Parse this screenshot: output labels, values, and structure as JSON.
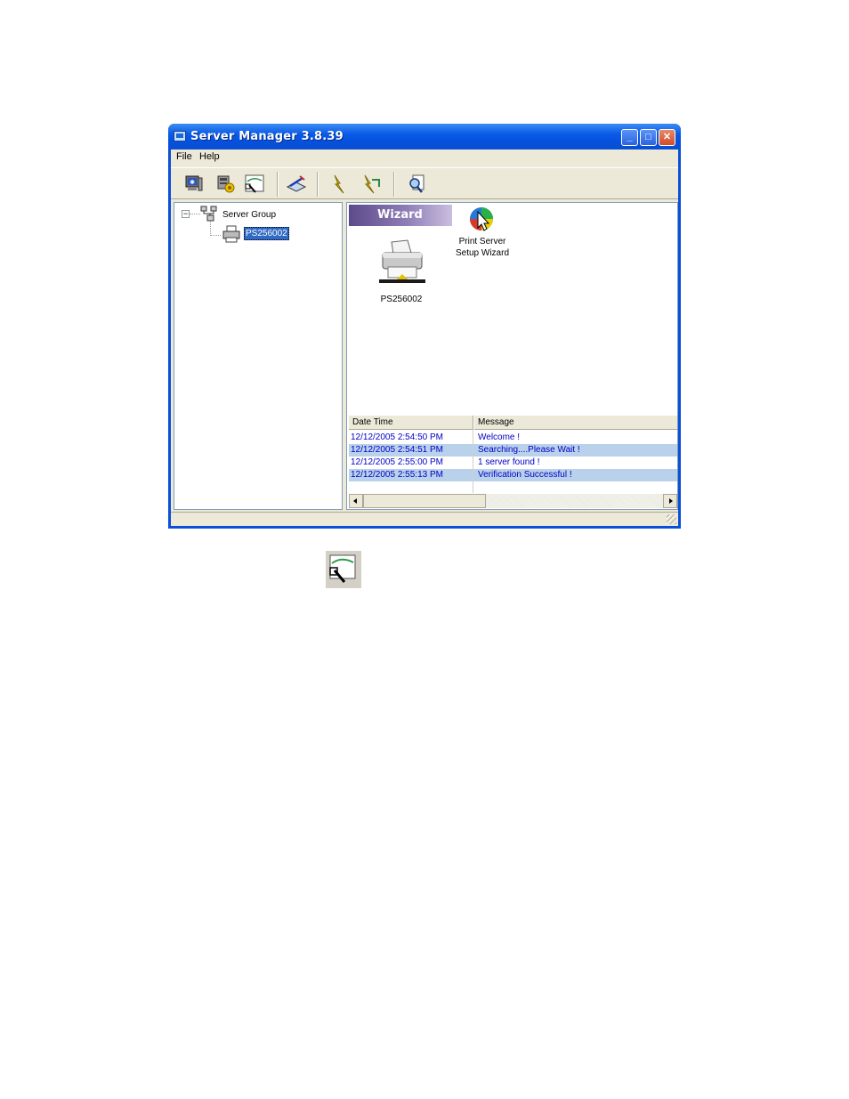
{
  "window": {
    "title": "Server Manager 3.8.39",
    "controls": {
      "minimize_glyph": "_",
      "maximize_glyph": "□",
      "close_glyph": "✕"
    }
  },
  "menu": {
    "file": "File",
    "help": "Help"
  },
  "toolbar": {
    "buttons": [
      "monitor-icon",
      "settings-icon",
      "wizard-icon",
      "edit-icon",
      "lightning-icon",
      "lightning-arrow-icon",
      "search-icon"
    ]
  },
  "tree": {
    "expander_glyph": "−",
    "group_label": "Server Group",
    "server_label": "PS256002"
  },
  "content": {
    "wizard_banner": "Wizard",
    "wizard_label_line1": "Print Server",
    "wizard_label_line2": "Setup Wizard",
    "server_label": "PS256002"
  },
  "log": {
    "columns": {
      "datetime": "Date Time",
      "message": "Message"
    },
    "rows": [
      {
        "datetime": "12/12/2005 2:54:50 PM",
        "message": "Welcome !"
      },
      {
        "datetime": "12/12/2005 2:54:51 PM",
        "message": "Searching....Please Wait !"
      },
      {
        "datetime": "12/12/2005 2:55:00 PM",
        "message": "1 server found !"
      },
      {
        "datetime": "12/12/2005 2:55:13 PM",
        "message": "Verification Successful !"
      }
    ]
  },
  "colors": {
    "titlebar": "#0a5be6",
    "selection": "#316ac5",
    "log_text": "#0000c8",
    "log_alt_row": "#b9d1ea",
    "wizard_banner": "#8e7cb6"
  }
}
